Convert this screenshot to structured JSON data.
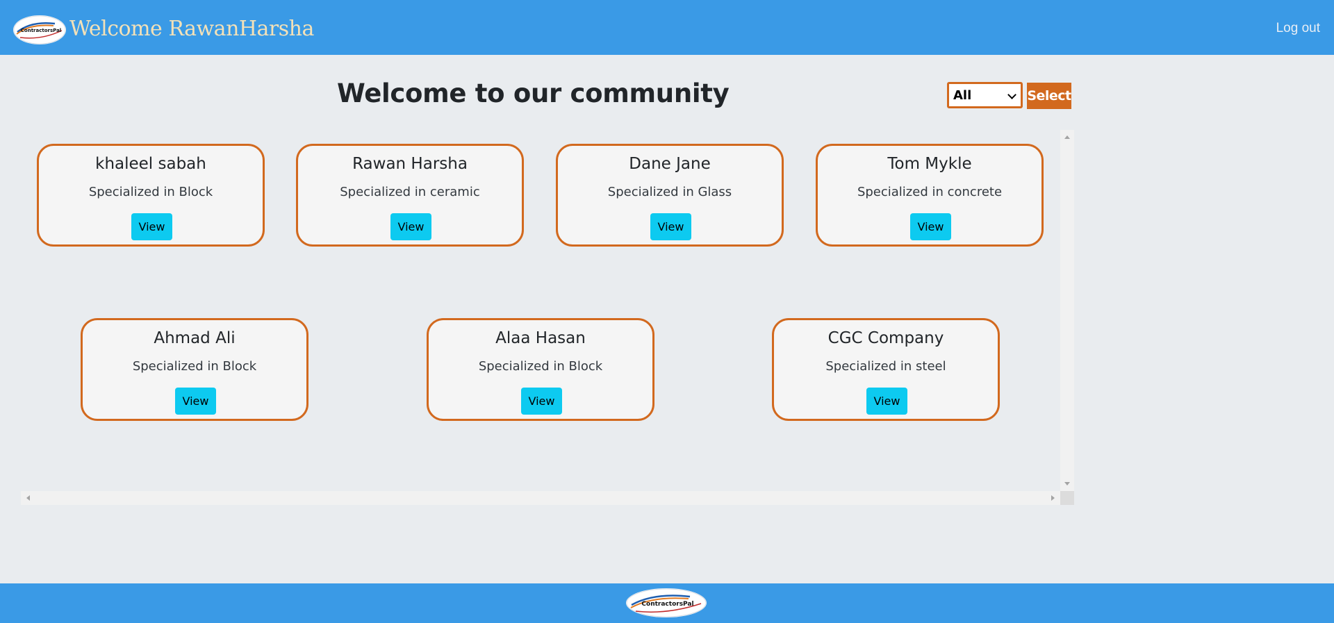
{
  "header": {
    "welcome_text": "Welcome RawanHarsha",
    "logout_label": "Log out",
    "logo_text": "ContractorsPal"
  },
  "main": {
    "title": "Welcome to our community",
    "filter": {
      "selected_option": "All",
      "button_label": "Select"
    },
    "cards": [
      {
        "name": "khaleel sabah",
        "specialty": "Specialized in Block",
        "button_label": "View"
      },
      {
        "name": "Rawan Harsha",
        "specialty": "Specialized in ceramic",
        "button_label": "View"
      },
      {
        "name": "Dane Jane",
        "specialty": "Specialized in Glass",
        "button_label": "View"
      },
      {
        "name": "Tom Mykle",
        "specialty": "Specialized in concrete",
        "button_label": "View"
      },
      {
        "name": "Ahmad Ali",
        "specialty": "Specialized in Block",
        "button_label": "View"
      },
      {
        "name": "Alaa Hasan",
        "specialty": "Specialized in Block",
        "button_label": "View"
      },
      {
        "name": "CGC Company",
        "specialty": "Specialized in steel",
        "button_label": "View"
      }
    ]
  },
  "footer": {
    "logo_text": "ContractorsPal"
  },
  "colors": {
    "header_bg": "#3a9ae6",
    "page_bg": "#e9ecef",
    "accent_orange": "#d2691e",
    "view_button": "#0dcaf0",
    "welcome_text": "#f3e1b8"
  },
  "icons": {
    "logo": "contractorspal-logo",
    "select_chevron": "chevron-down-icon"
  }
}
